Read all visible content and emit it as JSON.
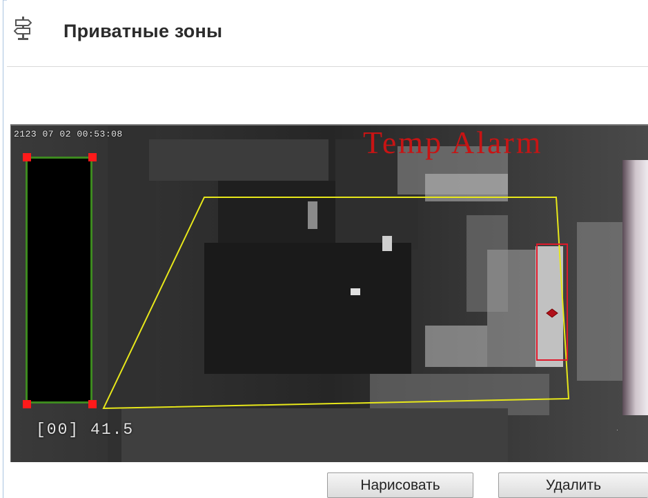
{
  "header": {
    "title": "Приватные зоны",
    "icon": "signpost-icon"
  },
  "video": {
    "timestamp": "2123 07 02 00:53:08",
    "alarm_text": "Temp Alarm",
    "temperature_readout": "[00] 41.5",
    "colors": {
      "privacy_border": "#3d8a1f",
      "handles": "#ff1a1a",
      "detection_region": "#e8e81a",
      "hotspot_box": "#e0182a",
      "alarm_text": "#c81414"
    }
  },
  "actions": {
    "draw_label": "Нарисовать",
    "delete_label": "Удалить"
  }
}
